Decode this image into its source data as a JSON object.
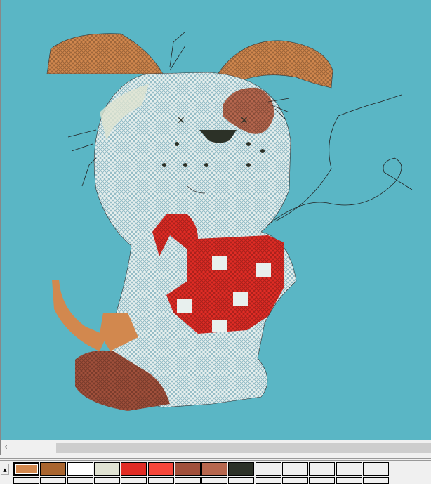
{
  "canvas": {
    "background": "#5ab6c5"
  },
  "scrollbar": {
    "left_arrow": "‹"
  },
  "palette": {
    "selected_index": 0,
    "colors": [
      "#d2884e",
      "#a9652f",
      "#ffffff",
      "#e1e3d3",
      "#e12c25",
      "#f6463a",
      "#a1503b",
      "#b7674e",
      "#2c3127",
      "#f0f0f0",
      "#f0f0f0",
      "#f0f0f0",
      "#f0f0f0",
      "#f0f0f0"
    ]
  }
}
